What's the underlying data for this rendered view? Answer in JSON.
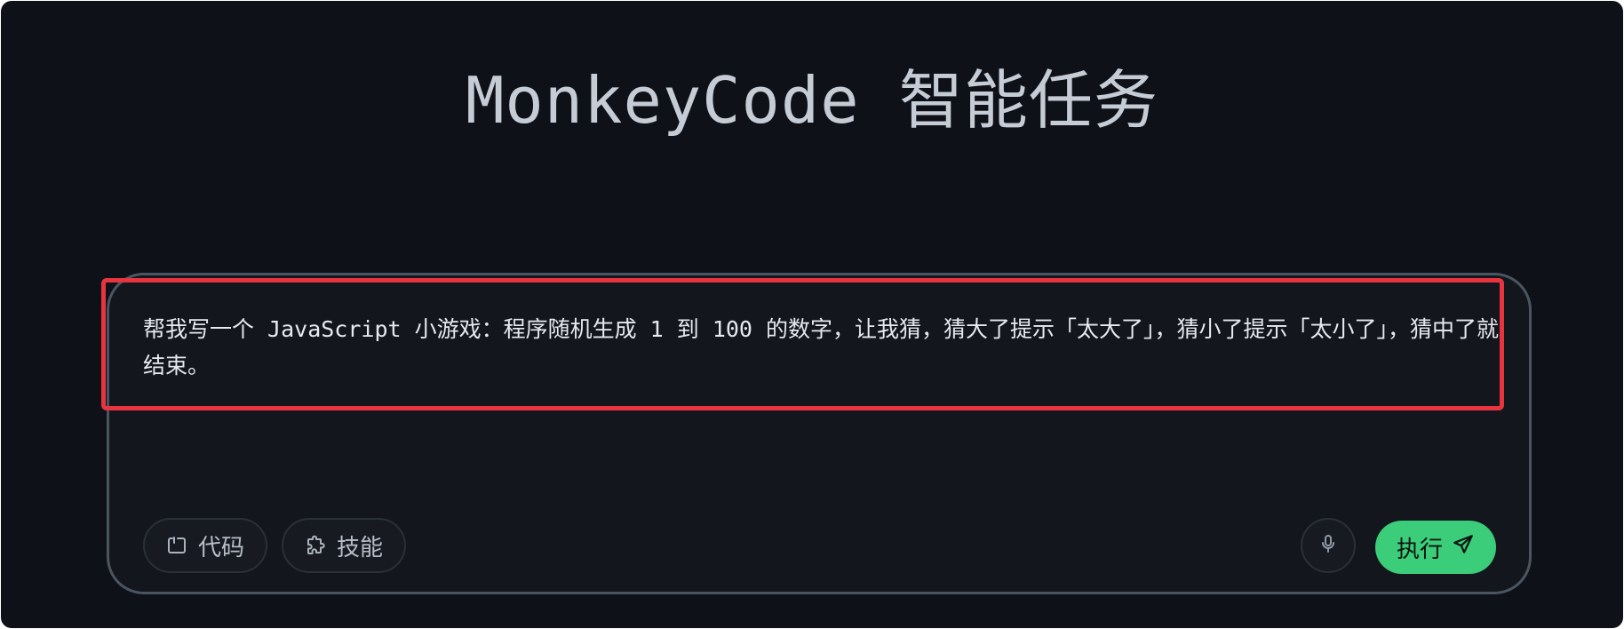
{
  "header": {
    "title": "MonkeyCode 智能任务"
  },
  "composer": {
    "prompt": "帮我写一个 JavaScript 小游戏：程序随机生成 1 到 100 的数字，让我猜，猜大了提示「太大了」，猜小了提示「太小了」，猜中了就结束。",
    "chips": [
      {
        "label": "代码",
        "icon": "code-bracket-icon"
      },
      {
        "label": "技能",
        "icon": "puzzle-icon"
      }
    ],
    "mic_icon": "microphone-icon",
    "run_label": "执行",
    "run_icon": "send-icon"
  },
  "colors": {
    "background": "#0e1117",
    "accent": "#3ccd7a",
    "highlight": "#e8343e"
  }
}
